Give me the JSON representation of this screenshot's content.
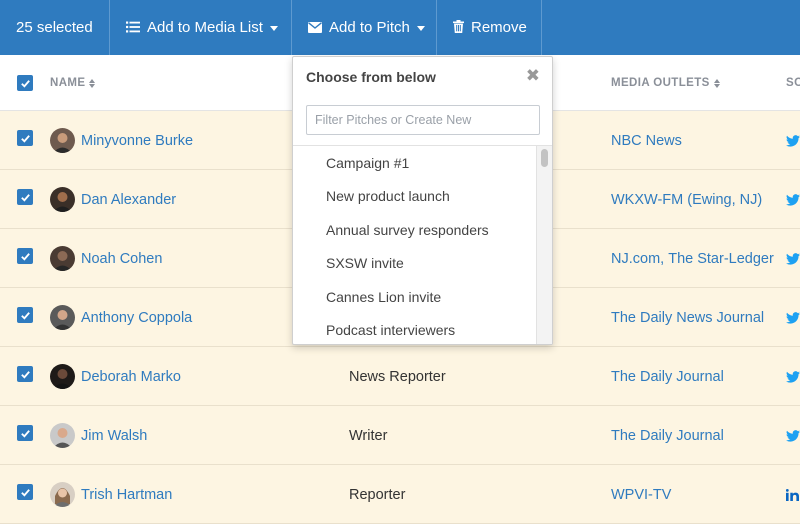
{
  "toolbar": {
    "selected_count": "25 selected",
    "add_to_media_list": "Add to Media List",
    "add_to_pitch": "Add to Pitch",
    "remove": "Remove"
  },
  "table": {
    "columns": {
      "name": "NAME",
      "media_outlets": "MEDIA OUTLETS",
      "social": "SO"
    },
    "rows": [
      {
        "name": "Minyvonne Burke",
        "title": "",
        "outlets": [
          "NBC News"
        ],
        "social": "twitter-icon"
      },
      {
        "name": "Dan Alexander",
        "title": "",
        "outlets": [
          "WKXW-FM (Ewing, NJ)"
        ],
        "social": "twitter-icon"
      },
      {
        "name": "Noah Cohen",
        "title": "",
        "outlets": [
          "NJ.com",
          "The Star-Ledger"
        ],
        "social": "twitter-icon"
      },
      {
        "name": "Anthony Coppola",
        "title": "",
        "outlets": [
          "The Daily News Journal"
        ],
        "social": "twitter-icon"
      },
      {
        "name": "Deborah Marko",
        "title": "News Reporter",
        "outlets": [
          "The Daily Journal"
        ],
        "social": "twitter-icon"
      },
      {
        "name": "Jim Walsh",
        "title": "Writer",
        "outlets": [
          "The Daily Journal"
        ],
        "social": "twitter-icon"
      },
      {
        "name": "Trish Hartman",
        "title": "Reporter",
        "outlets": [
          "WPVI-TV"
        ],
        "social": "linkedin-icon"
      }
    ]
  },
  "dropdown": {
    "header": "Choose from below",
    "filter_placeholder": "Filter Pitches or Create New",
    "items": [
      "Campaign #1",
      "New product launch",
      "Annual survey responders",
      "SXSW invite",
      "Cannes Lion invite",
      "Podcast interviewers"
    ]
  },
  "colors": {
    "primary": "#2f7bbf",
    "selected_row_bg": "#fdf5e2",
    "header_text": "#8a8f98",
    "twitter": "#1da1f2",
    "linkedin": "#0a66c2"
  }
}
